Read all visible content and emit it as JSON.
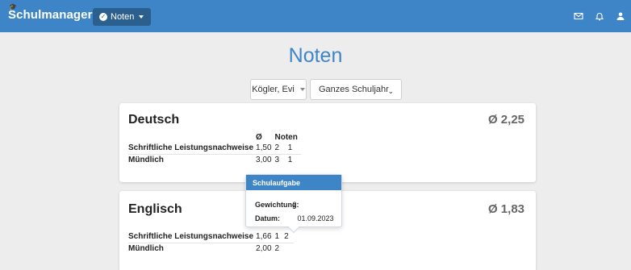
{
  "navbar": {
    "brand": "Schulmanager",
    "menu_button": "Noten",
    "icons": [
      "envelope-icon",
      "bell-icon",
      "user-icon"
    ]
  },
  "page": {
    "title": "Noten"
  },
  "filters": {
    "student": "Kögler, Evi",
    "period": "Ganzes Schuljahr"
  },
  "subjects": [
    {
      "name": "Deutsch",
      "average": "Ø 2,25",
      "header": {
        "avg": "Ø",
        "grades": "Noten"
      },
      "rows": [
        {
          "category": "Schriftliche Leistungsnachweise",
          "avg": "1,50",
          "grades": [
            "2",
            "1"
          ]
        },
        {
          "category": "Mündlich",
          "avg": "3,00",
          "grades": [
            "3",
            "1"
          ]
        }
      ]
    },
    {
      "name": "Englisch",
      "average": "Ø 1,83",
      "rows": [
        {
          "category": "Schriftliche Leistungsnachweise",
          "avg": "1,66",
          "grades": [
            "1",
            "2"
          ]
        },
        {
          "category": "Mündlich",
          "avg": "2,00",
          "grades": [
            "2"
          ]
        }
      ]
    }
  ],
  "popover": {
    "title": "Schulaufgabe",
    "weight_label": "Gewichtung:",
    "weight_value": "2",
    "date_label": "Datum:",
    "date_value": "01.09.2023"
  },
  "colors": {
    "primary": "#3d85c6",
    "dark_button": "#2b5f8e",
    "background": "#ededed"
  }
}
